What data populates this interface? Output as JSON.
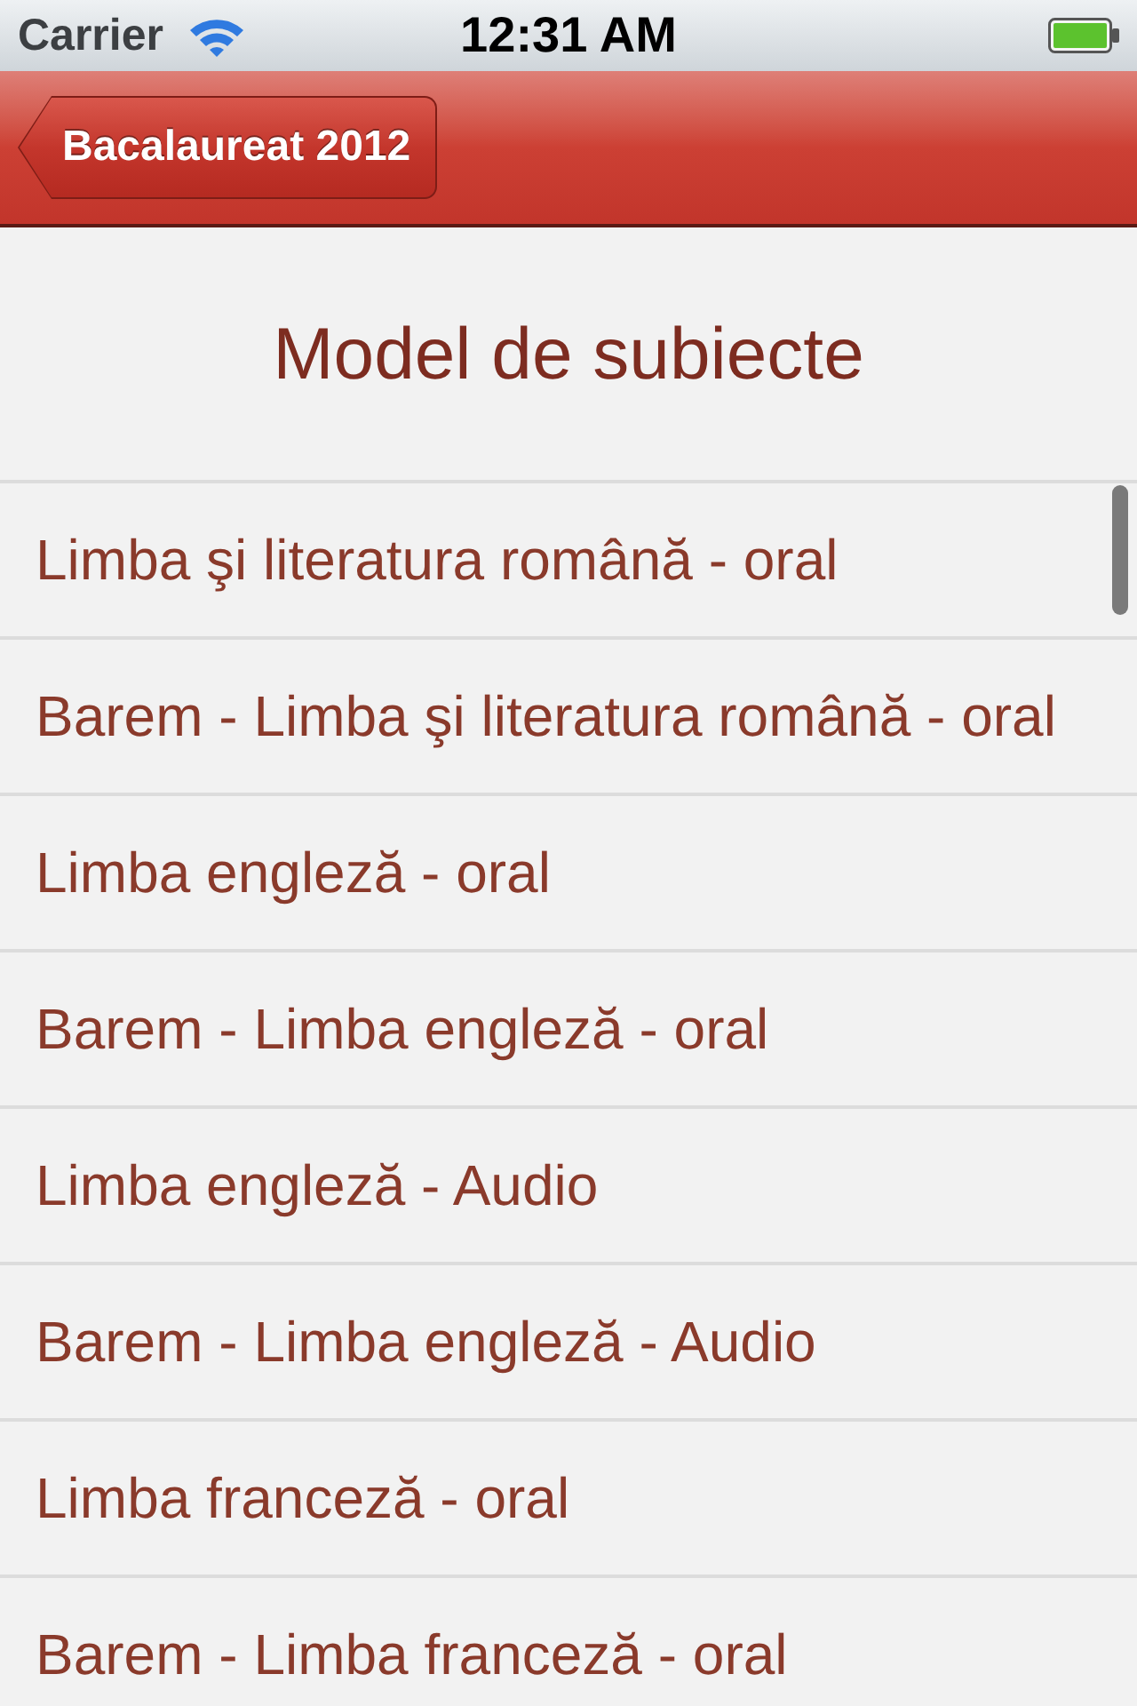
{
  "status_bar": {
    "carrier": "Carrier",
    "time": "12:31 AM"
  },
  "nav_bar": {
    "back_button": "Bacalaureat 2012"
  },
  "title": "Model de subiecte",
  "items": [
    {
      "label": "Limba şi literatura română - oral"
    },
    {
      "label": "Barem - Limba şi literatura română - oral"
    },
    {
      "label": "Limba engleză - oral"
    },
    {
      "label": "Barem - Limba engleză - oral"
    },
    {
      "label": "Limba engleză - Audio"
    },
    {
      "label": "Barem - Limba engleză - Audio"
    },
    {
      "label": "Limba franceză - oral"
    },
    {
      "label": "Barem - Limba franceză - oral"
    }
  ]
}
